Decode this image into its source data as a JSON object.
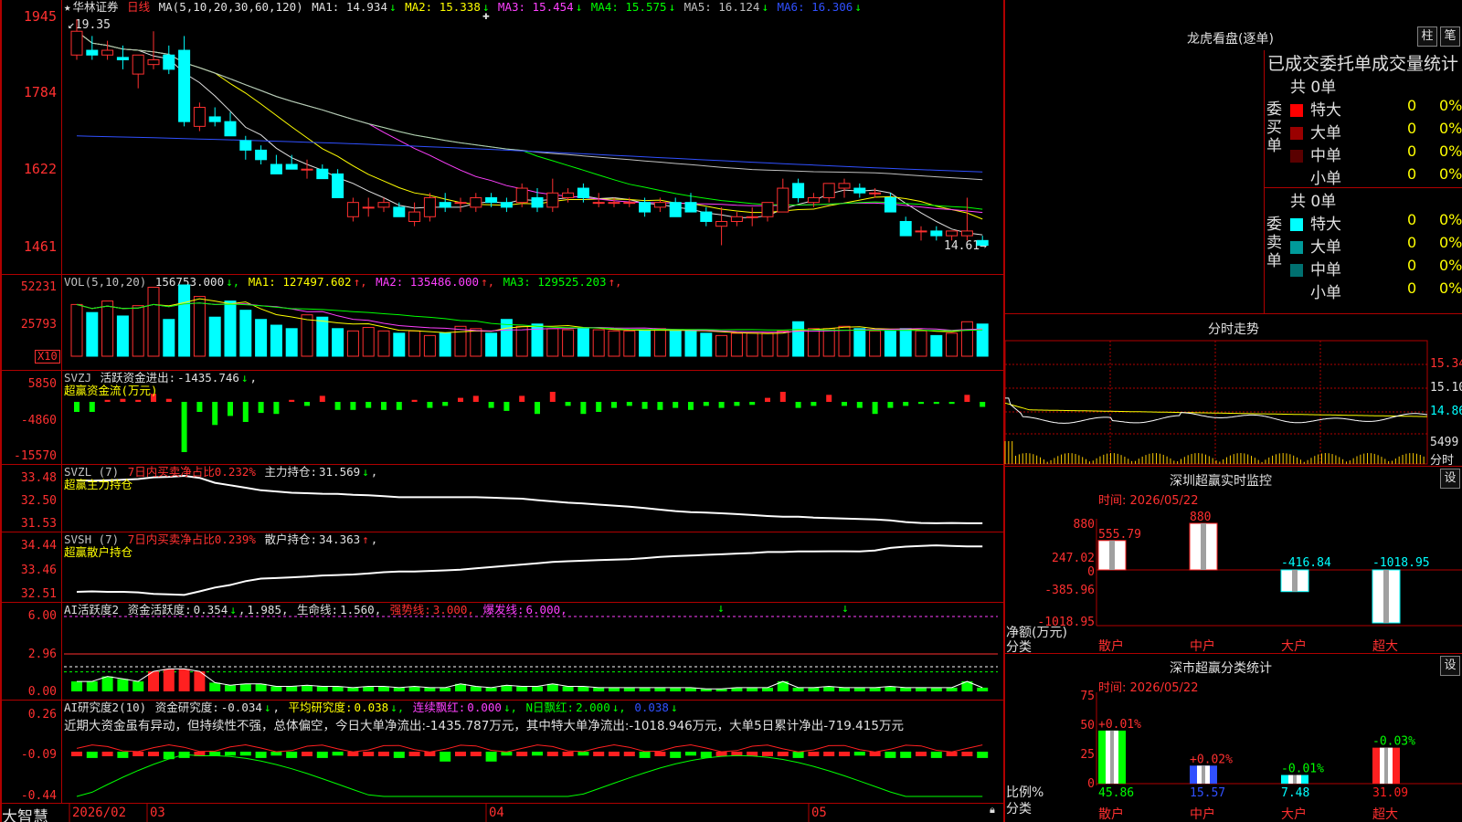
{
  "main": {
    "stock_name": "华林证券",
    "period": "日线",
    "ma_label": "MA(5,10,20,30,60,120)",
    "ma": [
      {
        "name": "MA1:",
        "value": "14.934",
        "arrow": "↓",
        "color": "#e0e0e0"
      },
      {
        "name": "MA2:",
        "value": "15.338",
        "arrow": "↓",
        "color": "#ffff00"
      },
      {
        "name": "MA3:",
        "value": "15.454",
        "arrow": "↓",
        "color": "#ff40ff"
      },
      {
        "name": "MA4:",
        "value": "15.575",
        "arrow": "↓",
        "color": "#00ff00"
      },
      {
        "name": "MA5:",
        "value": "16.124",
        "arrow": "↓",
        "color": "#c0c0c0"
      },
      {
        "name": "MA6:",
        "value": "16.306",
        "arrow": "↓",
        "color": "#3050ff"
      }
    ],
    "high_label": "19.35",
    "low_label": "14.61",
    "y_ticks": [
      "1945",
      "1784",
      "1622",
      "1461"
    ],
    "candles": [
      [
        18.6,
        19.35,
        18.5,
        19.1
      ],
      [
        18.7,
        19.0,
        18.5,
        18.6
      ],
      [
        18.6,
        18.9,
        18.5,
        18.7
      ],
      [
        18.55,
        18.8,
        18.3,
        18.5
      ],
      [
        18.2,
        18.6,
        17.9,
        18.6
      ],
      [
        18.4,
        19.1,
        18.3,
        18.5
      ],
      [
        18.6,
        18.8,
        18.2,
        18.3
      ],
      [
        18.7,
        19.0,
        17.1,
        17.2
      ],
      [
        17.1,
        17.6,
        17.0,
        17.5
      ],
      [
        17.3,
        17.5,
        17.1,
        17.2
      ],
      [
        17.2,
        17.4,
        16.9,
        16.9
      ],
      [
        16.8,
        16.9,
        16.4,
        16.6
      ],
      [
        16.6,
        16.7,
        16.3,
        16.4
      ],
      [
        16.3,
        16.5,
        16.1,
        16.1
      ],
      [
        16.3,
        16.5,
        16.2,
        16.2
      ],
      [
        16.2,
        16.4,
        16.0,
        16.2
      ],
      [
        16.2,
        16.3,
        16.0,
        16.0
      ],
      [
        16.1,
        16.2,
        15.6,
        15.6
      ],
      [
        15.2,
        15.6,
        15.1,
        15.5
      ],
      [
        15.4,
        15.6,
        15.2,
        15.4
      ],
      [
        15.4,
        15.6,
        15.3,
        15.5
      ],
      [
        15.4,
        15.5,
        15.2,
        15.2
      ],
      [
        15.1,
        15.5,
        15.0,
        15.3
      ],
      [
        15.2,
        15.7,
        15.1,
        15.6
      ],
      [
        15.5,
        15.7,
        15.3,
        15.4
      ],
      [
        15.5,
        15.6,
        15.3,
        15.5
      ],
      [
        15.4,
        15.7,
        15.3,
        15.6
      ],
      [
        15.6,
        15.7,
        15.4,
        15.5
      ],
      [
        15.5,
        15.6,
        15.3,
        15.4
      ],
      [
        15.5,
        15.9,
        15.4,
        15.8
      ],
      [
        15.6,
        15.8,
        15.3,
        15.4
      ],
      [
        15.4,
        16.0,
        15.3,
        15.7
      ],
      [
        15.6,
        15.8,
        15.5,
        15.7
      ],
      [
        15.8,
        15.9,
        15.5,
        15.6
      ],
      [
        15.5,
        15.7,
        15.4,
        15.5
      ],
      [
        15.5,
        15.6,
        15.4,
        15.5
      ],
      [
        15.5,
        15.6,
        15.4,
        15.5
      ],
      [
        15.5,
        15.6,
        15.2,
        15.3
      ],
      [
        15.4,
        15.6,
        15.3,
        15.5
      ],
      [
        15.5,
        15.6,
        15.2,
        15.2
      ],
      [
        15.5,
        15.7,
        15.3,
        15.3
      ],
      [
        15.3,
        15.4,
        15.0,
        15.1
      ],
      [
        15.0,
        15.4,
        14.6,
        15.1
      ],
      [
        15.1,
        15.3,
        15.0,
        15.2
      ],
      [
        15.2,
        15.4,
        15.0,
        15.2
      ],
      [
        15.2,
        15.5,
        15.1,
        15.5
      ],
      [
        15.3,
        16.0,
        15.3,
        15.8
      ],
      [
        15.9,
        16.0,
        15.5,
        15.6
      ],
      [
        15.5,
        15.7,
        15.4,
        15.6
      ],
      [
        15.6,
        15.9,
        15.5,
        15.9
      ],
      [
        15.8,
        16.0,
        15.6,
        15.9
      ],
      [
        15.8,
        15.9,
        15.6,
        15.7
      ],
      [
        15.7,
        15.8,
        15.6,
        15.7
      ],
      [
        15.6,
        15.7,
        15.3,
        15.3
      ],
      [
        15.1,
        15.2,
        14.8,
        14.8
      ],
      [
        14.9,
        15.0,
        14.7,
        14.9
      ],
      [
        14.9,
        15.0,
        14.7,
        14.8
      ],
      [
        14.8,
        14.9,
        14.7,
        14.9
      ],
      [
        14.8,
        15.6,
        14.7,
        14.9
      ],
      [
        14.7,
        14.8,
        14.6,
        14.6
      ]
    ]
  },
  "vol": {
    "label": "VOL(5,10,20)",
    "value": "156753.000",
    "ma": [
      {
        "name": "MA1:",
        "value": "127497.602",
        "arrow": "↑",
        "color": "#ffff00"
      },
      {
        "name": "MA2:",
        "value": "135486.000",
        "arrow": "↑",
        "color": "#ff40ff"
      },
      {
        "name": "MA3:",
        "value": "129525.203",
        "arrow": "↑",
        "color": "#00ff00"
      }
    ],
    "y_ticks": [
      "52231",
      "25793"
    ],
    "unit": "X10",
    "bars": [
      45,
      38,
      48,
      35,
      44,
      60,
      32,
      62,
      52,
      34,
      48,
      40,
      32,
      27,
      24,
      36,
      34,
      24,
      22,
      25,
      22,
      20,
      22,
      18,
      20,
      26,
      24,
      20,
      32,
      26,
      28,
      24,
      23,
      24,
      23,
      22,
      22,
      22,
      24,
      22,
      22,
      20,
      18,
      20,
      20,
      20,
      22,
      30,
      24,
      24,
      26,
      24,
      22,
      22,
      24,
      22,
      18,
      20,
      30,
      28
    ]
  },
  "svzj": {
    "label": "SVZJ",
    "name": "活跃资金进出:",
    "value": "-1435.746",
    "arrow": "↓",
    "sub": "超赢资金流(万元)",
    "y_ticks": [
      "5850",
      "-4860",
      "-15570"
    ],
    "bars": [
      -1,
      -1,
      0.2,
      0.3,
      0.2,
      0.8,
      0.3,
      -5,
      -1,
      -2.3,
      -1.4,
      -2,
      -1.1,
      -1.2,
      0.2,
      -0.4,
      0.6,
      -0.8,
      -0.8,
      -0.6,
      -0.8,
      -0.8,
      0.2,
      -0.6,
      -0.4,
      0.4,
      0.6,
      -0.6,
      -0.9,
      0.6,
      -1.2,
      1.0,
      -0.4,
      -1.2,
      -1,
      -0.6,
      -0.4,
      -0.7,
      -0.8,
      -0.6,
      -0.8,
      -0.4,
      -0.6,
      -0.4,
      -0.3,
      0.4,
      1.0,
      -0.6,
      -0.4,
      0.7,
      -0.4,
      -0.6,
      -1.2,
      -0.6,
      -0.4,
      -0.2,
      -0.2,
      -0.2,
      0.7,
      -0.5
    ]
  },
  "svzl": {
    "label": "SVZL (7)",
    "desc": "7日内买卖净占比0.232%",
    "name": "主力持仓:",
    "value": "31.569",
    "arrow": "↓",
    "sub": "超赢主力持仓",
    "y_ticks": [
      "33.48",
      "32.50",
      "31.53"
    ],
    "line": [
      33.3,
      33.28,
      33.3,
      33.32,
      33.35,
      33.42,
      33.44,
      33.48,
      33.4,
      33.2,
      33.1,
      33.0,
      32.9,
      32.85,
      32.8,
      32.78,
      32.76,
      32.75,
      32.72,
      32.7,
      32.66,
      32.62,
      32.62,
      32.62,
      32.62,
      32.62,
      32.62,
      32.6,
      32.58,
      32.56,
      32.5,
      32.45,
      32.4,
      32.37,
      32.32,
      32.28,
      32.24,
      32.18,
      32.12,
      32.06,
      32.02,
      32.0,
      31.97,
      31.94,
      31.9,
      31.86,
      31.83,
      31.83,
      31.8,
      31.78,
      31.76,
      31.74,
      31.72,
      31.69,
      31.62,
      31.58,
      31.57,
      31.58,
      31.57,
      31.57
    ]
  },
  "svsh": {
    "label": "SVSH (7)",
    "desc": "7日内买卖净占比0.239%",
    "name": "散户持仓:",
    "value": "34.363",
    "arrow": "↑",
    "sub": "超赢散户持仓",
    "y_ticks": [
      "34.44",
      "33.46",
      "32.51"
    ],
    "line": [
      32.58,
      32.6,
      32.58,
      32.58,
      32.56,
      32.5,
      32.48,
      32.46,
      32.6,
      32.75,
      32.85,
      33.0,
      33.1,
      33.12,
      33.15,
      33.18,
      33.22,
      33.24,
      33.26,
      33.3,
      33.35,
      33.38,
      33.38,
      33.4,
      33.42,
      33.45,
      33.5,
      33.55,
      33.6,
      33.65,
      33.7,
      33.75,
      33.78,
      33.8,
      33.82,
      33.84,
      33.86,
      33.9,
      33.95,
      33.98,
      34.0,
      34.03,
      34.05,
      34.08,
      34.1,
      34.14,
      34.14,
      34.16,
      34.16,
      34.17,
      34.17,
      34.16,
      34.2,
      34.3,
      34.35,
      34.38,
      34.4,
      34.38,
      34.36,
      34.36
    ]
  },
  "ai_active": {
    "label": "AI活跃度2",
    "name": "资金活跃度:",
    "value": "0.354",
    "arrow": "↓",
    "v2": "1.985,",
    "life_name": "生命线:",
    "life_value": "1.560,",
    "strong_name": "强势线:",
    "strong_value": "3.000,",
    "burst_name": "爆发线:",
    "burst_value": "6.000,",
    "y_ticks": [
      "6.00",
      "2.96",
      "0.00"
    ],
    "bars": [
      0.8,
      0.8,
      1.2,
      1.0,
      0.8,
      1.6,
      1.8,
      1.8,
      1.6,
      0.7,
      0.5,
      0.6,
      0.6,
      0.4,
      0.4,
      0.5,
      0.4,
      0.4,
      0.3,
      0.4,
      0.4,
      0.3,
      0.4,
      0.3,
      0.3,
      0.6,
      0.4,
      0.3,
      0.5,
      0.4,
      0.4,
      0.6,
      0.4,
      0.4,
      0.3,
      0.3,
      0.3,
      0.3,
      0.3,
      0.3,
      0.3,
      0.2,
      0.2,
      0.3,
      0.3,
      0.3,
      0.8,
      0.3,
      0.3,
      0.4,
      0.3,
      0.3,
      0.3,
      0.4,
      0.3,
      0.3,
      0.3,
      0.3,
      0.8,
      0.3
    ]
  },
  "ai_research": {
    "label": "AI研究度2(10)",
    "name": "资金研究度:",
    "value": "-0.034",
    "arrow": "↓",
    "avg_name": "平均研究度:",
    "avg_value": "0.038",
    "streak_name": "连续飘红:",
    "streak_value": "0.000",
    "nday_name": "N日飘红:",
    "nday_value": "2.000",
    "extra": "0.038",
    "comment": "近期大资金虽有异动，但持续性不强，总体偏空，今日大单净流出:-1435.787万元，其中特大单净流出:-1018.946万元，大单5日累计净出-719.415万元",
    "y_ticks": [
      "0.26",
      "-0.09",
      "-0.44"
    ],
    "bars": [
      -0.08,
      -0.06,
      -0.05,
      -0.06,
      -0.08,
      -0.04,
      -0.05,
      -0.06,
      -0.06,
      -0.08,
      -0.08,
      -0.08,
      -0.06,
      -0.08,
      -0.06,
      -0.08,
      -0.06,
      -0.08,
      -0.08,
      -0.08,
      -0.08,
      -0.12,
      -0.08,
      -0.06,
      -0.03,
      -0.08,
      -0.06,
      -0.03,
      -0.08,
      -0.06,
      -0.08,
      -0.04,
      -0.06,
      -0.08,
      -0.06,
      -0.04,
      -0.08,
      -0.06,
      -0.06,
      -0.06,
      -0.08,
      -0.06,
      -0.06,
      -0.08,
      -0.06,
      -0.06,
      -0.03,
      -0.06,
      -0.08,
      -0.05,
      -0.06,
      -0.08,
      -0.06,
      -0.06,
      -0.06,
      -0.06,
      -0.06,
      -0.06,
      -0.03,
      -0.06
    ]
  },
  "xaxis": {
    "labels": [
      "2026/02",
      "03",
      "04",
      "05"
    ],
    "app": "大智慧"
  },
  "longhu": {
    "title": "龙虎看盘(逐单)",
    "btn1": "柱",
    "btn2": "笔",
    "header": "已成交委托单成交量统计",
    "buy_label": "委买单",
    "sell_label": "委卖单",
    "buy_total": "共 0单",
    "sell_total": "共 0单",
    "buy_rows": [
      {
        "name": "特大",
        "count": "0",
        "pct": "0%",
        "color": "#ff0000"
      },
      {
        "name": "大单",
        "count": "0",
        "pct": "0%",
        "color": "#9a0000"
      },
      {
        "name": "中单",
        "count": "0",
        "pct": "0%",
        "color": "#5a0000"
      },
      {
        "name": "小单",
        "count": "0",
        "pct": "0%",
        "color": "#000000"
      }
    ],
    "sell_rows": [
      {
        "name": "特大",
        "count": "0",
        "pct": "0%",
        "color": "#00ffff"
      },
      {
        "name": "大单",
        "count": "0",
        "pct": "0%",
        "color": "#009a9a"
      },
      {
        "name": "中单",
        "count": "0",
        "pct": "0%",
        "color": "#007070"
      },
      {
        "name": "小单",
        "count": "0",
        "pct": "0%",
        "color": "#000000"
      }
    ]
  },
  "fenshi": {
    "title": "分时走势",
    "y_ticks": [
      "15.34",
      "15.10",
      "14.86"
    ],
    "vol_tick": "5499",
    "vol_unit": "分时"
  },
  "sz_monitor": {
    "title": "深圳超赢实时监控",
    "btn": "设",
    "time_label": "时间:",
    "time": "2026/05/22",
    "y_ticks": [
      "880",
      "247.02",
      "0",
      "-385.96",
      "-1018.95"
    ],
    "axis_label": "净额(万元)",
    "axis_label2": "分类",
    "cats": [
      "散户",
      "中户",
      "大户",
      "超大"
    ],
    "values": [
      555.79,
      880,
      -416.84,
      -1018.95
    ],
    "value_labels": [
      "555.79",
      "880",
      "-416.84",
      "-1018.95"
    ]
  },
  "sz_class": {
    "title": "深市超赢分类统计",
    "btn": "设",
    "time_label": "时间:",
    "time": "2026/05/22",
    "y_ticks": [
      "75",
      "50",
      "25",
      "0"
    ],
    "axis_label": "比例%",
    "axis_label2": "分类",
    "cats": [
      "散户",
      "中户",
      "大户",
      "超大"
    ],
    "values": [
      45.86,
      15.57,
      7.48,
      31.09
    ],
    "changes": [
      "+0.01%",
      "+0.02%",
      "-0.01%",
      "-0.03%"
    ],
    "value_labels": [
      "45.86",
      "15.57",
      "7.48",
      "31.09"
    ]
  }
}
